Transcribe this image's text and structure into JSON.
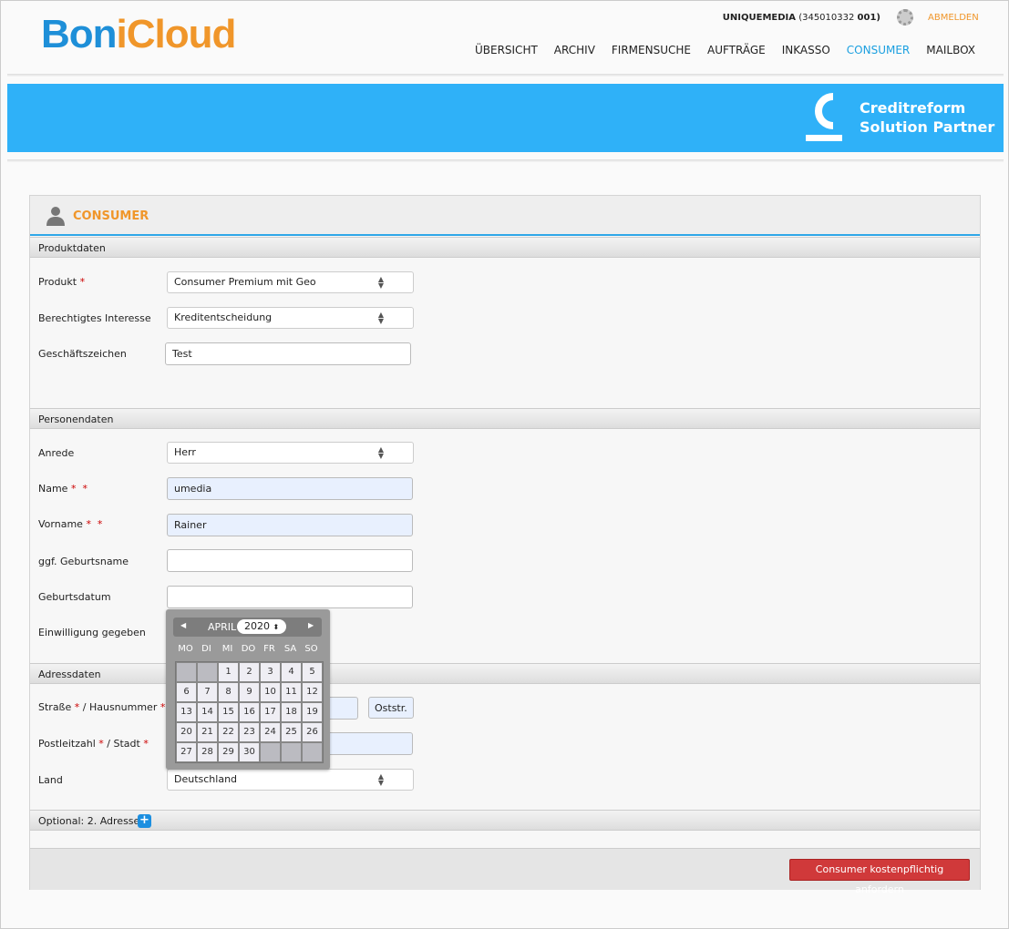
{
  "header": {
    "logo": {
      "part1": "Bon",
      "part2": "i",
      "part3": "Cloud"
    },
    "user_name": "UNIQUEMEDIA",
    "user_id": "(345010332",
    "user_sub": "001)",
    "logout": "ABMELDEN",
    "nav": [
      "ÜBERSICHT",
      "ARCHIV",
      "FIRMENSUCHE",
      "AUFTRÄGE",
      "INKASSO",
      "CONSUMER",
      "MAILBOX"
    ],
    "active_nav": "CONSUMER"
  },
  "banner": {
    "line1": "Creditreform",
    "line2": "Solution Partner",
    "color": "#2fb1f8"
  },
  "panel": {
    "title": "CONSUMER",
    "sections": {
      "produkt": "Produktdaten",
      "person": "Personendaten",
      "adresse": "Adressdaten",
      "optional": "Optional: 2. Adresse"
    },
    "fields": {
      "produkt": {
        "label": "Produkt",
        "value": "Consumer Premium mit Geo"
      },
      "interesse": {
        "label": "Berechtigtes Interesse",
        "value": "Kreditentscheidung"
      },
      "zeichen": {
        "label": "Geschäftszeichen",
        "value": "Test"
      },
      "anrede": {
        "label": "Anrede",
        "value": "Herr"
      },
      "name": {
        "label": "Name",
        "value": "umedia"
      },
      "vorname": {
        "label": "Vorname",
        "value": "Rainer"
      },
      "geburtsname": {
        "label": "ggf. Geburtsname",
        "value": ""
      },
      "geburtsdatum": {
        "label": "Geburtsdatum",
        "value": ""
      },
      "einwilligung": {
        "label": "Einwilligung gegeben"
      },
      "strasse": {
        "label": "Straße",
        "label2": "/ Hausnummer",
        "value": "",
        "button": "Oststr."
      },
      "plz": {
        "label": "Postleitzahl",
        "label2": "/ Stadt",
        "value": ""
      },
      "land": {
        "label": "Land",
        "value": "Deutschland"
      }
    },
    "submit": "Consumer kostenpflichtig anfordern"
  },
  "datepicker": {
    "month": "APRIL",
    "year": "2020",
    "weekdays": [
      "MO",
      "DI",
      "MI",
      "DO",
      "FR",
      "SA",
      "SO"
    ],
    "days": [
      "",
      "",
      "1",
      "2",
      "3",
      "4",
      "5",
      "6",
      "7",
      "8",
      "9",
      "10",
      "11",
      "12",
      "13",
      "14",
      "15",
      "16",
      "17",
      "18",
      "19",
      "20",
      "21",
      "22",
      "23",
      "24",
      "25",
      "26",
      "27",
      "28",
      "29",
      "30",
      "",
      "",
      ""
    ]
  }
}
